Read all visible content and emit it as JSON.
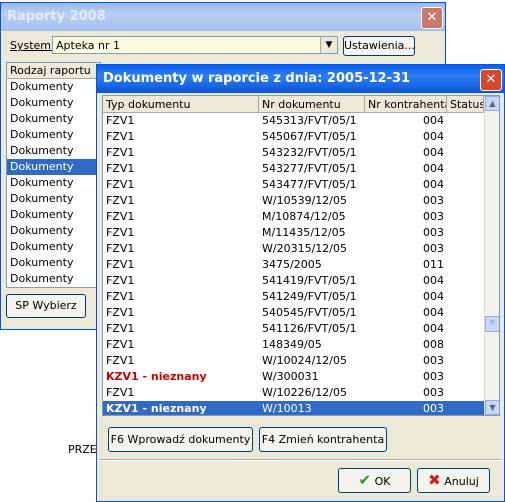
{
  "back_window": {
    "title": "Raporty 2008",
    "system_label": "System:",
    "system_value": "Apteka nr 1",
    "settings_button": "Ustawienia...",
    "list_header": "Rodzaj raportu",
    "list_items": [
      "Dokumenty",
      "Dokumenty",
      "Dokumenty",
      "Dokumenty",
      "Dokumenty",
      "Dokumenty",
      "Dokumenty",
      "Dokumenty",
      "Dokumenty",
      "Dokumenty",
      "Dokumenty",
      "Dokumenty",
      "Dokumenty"
    ],
    "selected_index": 5,
    "sp_button": "SP Wybierz",
    "partial_text": "PRZE"
  },
  "front_window": {
    "title": "Dokumenty w raporcie z dnia: 2005-12-31",
    "columns": [
      "Typ dokumentu",
      "Nr dokumentu",
      "Nr kontrahenta",
      "Status"
    ],
    "rows": [
      {
        "type": "FZV1",
        "nr": "545313/FVT/05/1",
        "kontr": "004"
      },
      {
        "type": "FZV1",
        "nr": "545067/FVT/05/1",
        "kontr": "004"
      },
      {
        "type": "FZV1",
        "nr": "543232/FVT/05/1",
        "kontr": "004"
      },
      {
        "type": "FZV1",
        "nr": "543277/FVT/05/1",
        "kontr": "004"
      },
      {
        "type": "FZV1",
        "nr": "543477/FVT/05/1",
        "kontr": "004"
      },
      {
        "type": "FZV1",
        "nr": "W/10539/12/05",
        "kontr": "003"
      },
      {
        "type": "FZV1",
        "nr": "M/10874/12/05",
        "kontr": "003"
      },
      {
        "type": "FZV1",
        "nr": "M/11435/12/05",
        "kontr": "003"
      },
      {
        "type": "FZV1",
        "nr": "W/20315/12/05",
        "kontr": "003"
      },
      {
        "type": "FZV1",
        "nr": "3475/2005",
        "kontr": "011"
      },
      {
        "type": "FZV1",
        "nr": "541419/FVT/05/1",
        "kontr": "004"
      },
      {
        "type": "FZV1",
        "nr": "541249/FVT/05/1",
        "kontr": "004"
      },
      {
        "type": "FZV1",
        "nr": "540545/FVT/05/1",
        "kontr": "004"
      },
      {
        "type": "FZV1",
        "nr": "541126/FVT/05/1",
        "kontr": "004"
      },
      {
        "type": "FZV1",
        "nr": "148349/05",
        "kontr": "008"
      },
      {
        "type": "FZV1",
        "nr": "W/10024/12/05",
        "kontr": "003"
      },
      {
        "type": "KZV1 - nieznany",
        "nr": "W/300031",
        "kontr": "003",
        "red": true
      },
      {
        "type": "FZV1",
        "nr": "W/10226/12/05",
        "kontr": "003"
      },
      {
        "type": "KZV1 - nieznany",
        "nr": "W/10013",
        "kontr": "003",
        "red": true,
        "selected": true
      }
    ],
    "scroll_position": 0.75,
    "import_button": "F6  Wprowadź dokumenty",
    "change_button": "F4  Zmień kontrahenta",
    "ok_button": "OK",
    "cancel_button": "Anuluj"
  }
}
